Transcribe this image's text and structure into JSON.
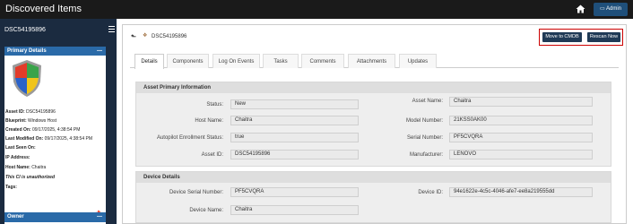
{
  "app": {
    "title": "Discovered Items",
    "admin_label": "Admin"
  },
  "sidebar": {
    "title": "DSC54195896",
    "primary_details": {
      "header": "Primary Details",
      "collapse": "—",
      "asset_id_label": "Asset ID:",
      "asset_id": "DSC54195896",
      "blueprint_label": "Blueprint:",
      "blueprint": "Windows Host",
      "created_label": "Created On:",
      "created": "09/17/2025, 4:38:54 PM",
      "modified_label": "Last Modified On:",
      "modified": "09/17/2025, 4:38:54 PM",
      "last_seen_label": "Last Seen On:",
      "ip_label": "IP Address:",
      "host_label": "Host Name:",
      "host": "Chaitra",
      "unauthorized": "This CI is unauthorized",
      "tags_label": "Tags:"
    },
    "owner": {
      "header": "Owner",
      "collapse": "—"
    }
  },
  "main": {
    "breadcrumb": "DSC54195896",
    "move_button": "Move to CMDB",
    "rescan_button": "Rescan Now",
    "tabs": [
      "Details",
      "Components",
      "Log On Events",
      "Tasks",
      "Comments",
      "Attachments",
      "Updates"
    ],
    "asset_section": {
      "title": "Asset Primary Information",
      "status_label": "Status:",
      "status": "New",
      "host_label": "Host Name:",
      "host": "Chaitra",
      "autopilot_label": "Autopilot Enrollment Status:",
      "autopilot": "true",
      "asset_id_label": "Asset ID:",
      "asset_id": "DSC54195896",
      "asset_name_label": "Asset Name:",
      "asset_name": "Chaitra",
      "model_label": "Model Number:",
      "model": "21KSS0AK00",
      "serial_label": "Serial Number:",
      "serial": "PF5CVQRA",
      "manufacturer_label": "Manufacturer:",
      "manufacturer": "LENOVO"
    },
    "device_section": {
      "title": "Device Details",
      "serial_label": "Device Serial Number:",
      "serial": "PF5CVQRA",
      "name_label": "Device Name:",
      "name": "Chaitra",
      "id_label": "Device ID:",
      "id": "94e1622e-4c5c-4046-afe7-ee8a219555dd"
    }
  }
}
